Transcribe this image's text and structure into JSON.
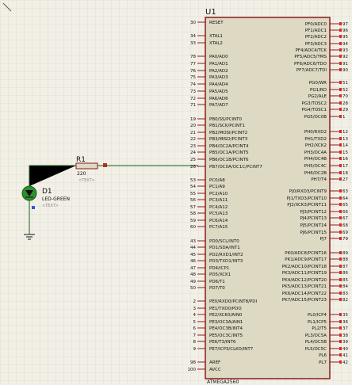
{
  "schematic": {
    "chip": {
      "ref": "U1",
      "part": "ATMEGA2560",
      "left_pins": [
        {
          "num": "30",
          "label": "RESET"
        },
        {
          "num": "34",
          "label": "XTAL1"
        },
        {
          "num": "33",
          "label": "XTAL2"
        },
        {
          "num": "78",
          "label": "PA0/AD0"
        },
        {
          "num": "77",
          "label": "PA1/AD1"
        },
        {
          "num": "76",
          "label": "PA2/AD2"
        },
        {
          "num": "75",
          "label": "PA3/AD3"
        },
        {
          "num": "74",
          "label": "PA4/AD4"
        },
        {
          "num": "73",
          "label": "PA5/AD5"
        },
        {
          "num": "72",
          "label": "PA6/AD6"
        },
        {
          "num": "71",
          "label": "PA7/AD7"
        },
        {
          "num": "19",
          "label": "PB0/SS/PCINT0"
        },
        {
          "num": "20",
          "label": "PB1/SCK/PCINT1"
        },
        {
          "num": "21",
          "label": "PB2/MOSI/PCINT2"
        },
        {
          "num": "22",
          "label": "PB3/MISO/PCINT3"
        },
        {
          "num": "23",
          "label": "PB4/OC2A/PCINT4"
        },
        {
          "num": "24",
          "label": "PB5/OC1A/PCINT5"
        },
        {
          "num": "25",
          "label": "PB6/OC1B/PCINT6"
        },
        {
          "num": "26",
          "label": "PB7/OC0A/OC1C/PCINT7"
        },
        {
          "num": "53",
          "label": "PC0/A8"
        },
        {
          "num": "54",
          "label": "PC1/A9"
        },
        {
          "num": "55",
          "label": "PC2/A10"
        },
        {
          "num": "56",
          "label": "PC3/A11"
        },
        {
          "num": "57",
          "label": "PC4/A12"
        },
        {
          "num": "58",
          "label": "PC5/A13"
        },
        {
          "num": "59",
          "label": "PC6/A14"
        },
        {
          "num": "60",
          "label": "PC7/A15"
        },
        {
          "num": "43",
          "label": "PD0/SCL/INT0"
        },
        {
          "num": "44",
          "label": "PD1/SDA/INT1"
        },
        {
          "num": "45",
          "label": "PD2/RXD1/INT2"
        },
        {
          "num": "46",
          "label": "PD3/TXD1/INT3"
        },
        {
          "num": "47",
          "label": "PD4/ICP1"
        },
        {
          "num": "48",
          "label": "PD5/XCK1"
        },
        {
          "num": "49",
          "label": "PD6/T1"
        },
        {
          "num": "50",
          "label": "PD7/T0"
        },
        {
          "num": "2",
          "label": "PE0/RXD0/PCINT8/PDI"
        },
        {
          "num": "3",
          "label": "PE1/TXD0/PDO"
        },
        {
          "num": "4",
          "label": "PE2/XCK0/AIN0"
        },
        {
          "num": "5",
          "label": "PE3/OC3A/AIN1"
        },
        {
          "num": "6",
          "label": "PE4/OC3B/INT4"
        },
        {
          "num": "7",
          "label": "PE5/OC3C/INT5"
        },
        {
          "num": "8",
          "label": "PE6/T3/INT6"
        },
        {
          "num": "9",
          "label": "PE7/ICP3/CLKO/INT7"
        },
        {
          "num": "98",
          "label": "AREF"
        },
        {
          "num": "100",
          "label": "AVCC"
        }
      ],
      "right_pins": [
        {
          "num": "97",
          "label": "PF0/ADC0"
        },
        {
          "num": "96",
          "label": "PF1/ADC1"
        },
        {
          "num": "95",
          "label": "PF2/ADC2"
        },
        {
          "num": "94",
          "label": "PF3/ADC3"
        },
        {
          "num": "93",
          "label": "PF4/ADC4/TCK"
        },
        {
          "num": "92",
          "label": "PF5/ADC5/TMS"
        },
        {
          "num": "91",
          "label": "PF6/ADC6/TDO"
        },
        {
          "num": "90",
          "label": "PF7/ADC7/TDI"
        },
        {
          "num": "51",
          "label": "PG0/WR"
        },
        {
          "num": "52",
          "label": "PG1/RD"
        },
        {
          "num": "70",
          "label": "PG2/ALE"
        },
        {
          "num": "28",
          "label": "PG3/TOSC2"
        },
        {
          "num": "29",
          "label": "PG4/TOSC1"
        },
        {
          "num": "1",
          "label": "PG5/OC0B"
        },
        {
          "num": "12",
          "label": "PH0/RXD2"
        },
        {
          "num": "13",
          "label": "PH1/TXD2"
        },
        {
          "num": "14",
          "label": "PH2/XCK2"
        },
        {
          "num": "15",
          "label": "PH3/OC4A"
        },
        {
          "num": "16",
          "label": "PH4/OC4B"
        },
        {
          "num": "17",
          "label": "PH5/OC4C"
        },
        {
          "num": "18",
          "label": "PH6/OC2B"
        },
        {
          "num": "27",
          "label": "PH7/T4"
        },
        {
          "num": "63",
          "label": "PJ0/RXD3/PCINT9"
        },
        {
          "num": "64",
          "label": "PJ1/TXD3/PCINT10"
        },
        {
          "num": "65",
          "label": "PJ2/XCK3/PCINT11"
        },
        {
          "num": "66",
          "label": "PJ3/PCINT12"
        },
        {
          "num": "67",
          "label": "PJ4/PCINT13"
        },
        {
          "num": "68",
          "label": "PJ5/PCINT14"
        },
        {
          "num": "69",
          "label": "PJ6/PCINT15"
        },
        {
          "num": "79",
          "label": "PJ7"
        },
        {
          "num": "89",
          "label": "PK0/ADC8/PCINT16"
        },
        {
          "num": "88",
          "label": "PK1/ADC9/PCINT17"
        },
        {
          "num": "87",
          "label": "PK2/ADC10/PCINT18"
        },
        {
          "num": "86",
          "label": "PK3/ADC11/PCINT19"
        },
        {
          "num": "85",
          "label": "PK4/ADC12/PCINT20"
        },
        {
          "num": "84",
          "label": "PK5/ADC13/PCINT21"
        },
        {
          "num": "83",
          "label": "PK6/ADC14/PCINT22"
        },
        {
          "num": "82",
          "label": "PK7/ADC15/PCINT23"
        },
        {
          "num": "35",
          "label": "PL0/ICP4"
        },
        {
          "num": "36",
          "label": "PL1/ICP5"
        },
        {
          "num": "37",
          "label": "PL2/T5"
        },
        {
          "num": "38",
          "label": "PL3/OC5A"
        },
        {
          "num": "39",
          "label": "PL4/OC5B"
        },
        {
          "num": "40",
          "label": "PL5/OC5C"
        },
        {
          "num": "41",
          "label": "PL6"
        },
        {
          "num": "42",
          "label": "PL7"
        }
      ]
    },
    "resistor": {
      "ref": "R1",
      "value": "220",
      "text": "<TEXT>"
    },
    "led": {
      "ref": "D1",
      "part": "LED-GREEN",
      "text": "<TEXT>"
    }
  },
  "colors": {
    "background": "#f2f0e6",
    "grid": "#d4d1c4",
    "chip_outline": "#8c1a1a",
    "chip_fill": "#ddd9c3",
    "wire": "#1b5e20",
    "pin_dot": "#d62828",
    "led_green": "#2f8f2f",
    "label_text": "#111111"
  }
}
